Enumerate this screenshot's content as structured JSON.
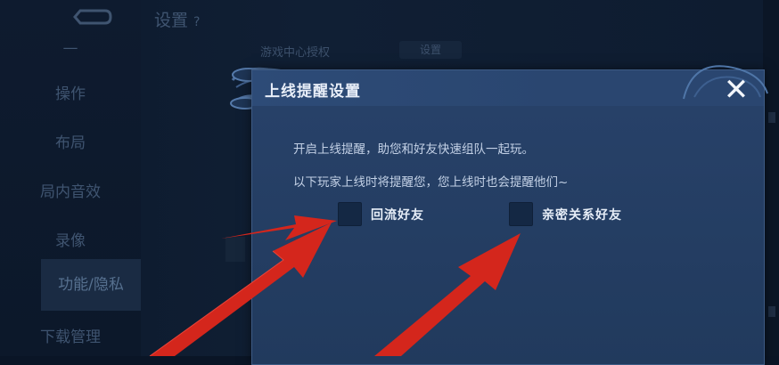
{
  "background": {
    "settings_title": "设置",
    "nav_items": [
      "操作",
      "布局",
      "局内音效",
      "录像",
      "功能/隐私",
      "下载管理"
    ],
    "active_nav": "功能/隐私",
    "game_center_auth_label": "游戏中心授权",
    "game_center_auth_button": "设置"
  },
  "dialog": {
    "title": "上线提醒设置",
    "close_icon": "close-icon",
    "description_line1": "开启上线提醒，助您和好友快速组队一起玩。",
    "description_line2": "以下玩家上线时将提醒您，您上线时也会提醒他们~",
    "options": [
      {
        "label": "回流好友",
        "checked": false
      },
      {
        "label": "亲密关系好友",
        "checked": false
      }
    ]
  },
  "annotations": {
    "arrow_color": "#d4261c"
  }
}
